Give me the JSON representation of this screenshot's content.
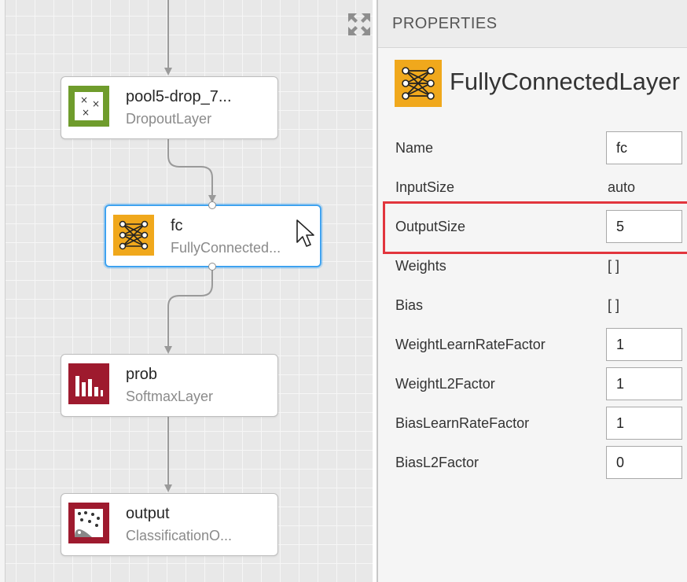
{
  "canvas": {
    "nodes": [
      {
        "id": "pool5-drop",
        "name": "pool5-drop_7...",
        "type": "DropoutLayer",
        "icon": "dropout-icon",
        "color": "#6f9c2c"
      },
      {
        "id": "fc",
        "name": "fc",
        "type": "FullyConnected...",
        "icon": "fully-connected-icon",
        "color": "#f0a81c",
        "selected": true
      },
      {
        "id": "prob",
        "name": "prob",
        "type": "SoftmaxLayer",
        "icon": "softmax-icon",
        "color": "#9e1a2e"
      },
      {
        "id": "output",
        "name": "output",
        "type": "ClassificationO...",
        "icon": "classification-output-icon",
        "color": "#9e1a2e"
      }
    ],
    "selection_color": "#3fa3f0"
  },
  "panel": {
    "title": "PROPERTIES",
    "layer_title": "FullyConnectedLayer",
    "layer_icon": "fully-connected-icon",
    "properties": [
      {
        "label": "Name",
        "value": "fc",
        "editable": true
      },
      {
        "label": "InputSize",
        "value": "auto",
        "editable": false
      },
      {
        "label": "OutputSize",
        "value": "5",
        "editable": true,
        "highlighted": true
      },
      {
        "label": "Weights",
        "value": "[ ]",
        "editable": false
      },
      {
        "label": "Bias",
        "value": "[ ]",
        "editable": false
      },
      {
        "label": "WeightLearnRateFactor",
        "value": "1",
        "editable": true
      },
      {
        "label": "WeightL2Factor",
        "value": "1",
        "editable": true
      },
      {
        "label": "BiasLearnRateFactor",
        "value": "1",
        "editable": true
      },
      {
        "label": "BiasL2Factor",
        "value": "0",
        "editable": true
      }
    ],
    "highlight_color": "#e2353d"
  }
}
